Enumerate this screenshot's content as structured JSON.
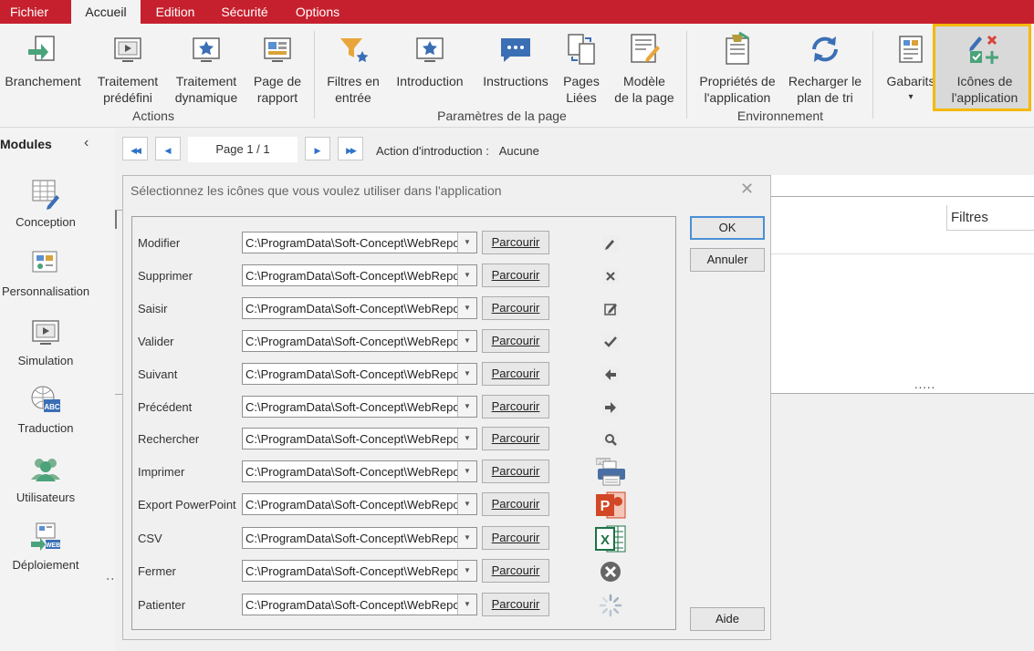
{
  "tabs": [
    {
      "label": "Fichier",
      "active": false
    },
    {
      "label": "Accueil",
      "active": true
    },
    {
      "label": "Edition",
      "active": false
    },
    {
      "label": "Sécurité",
      "active": false
    },
    {
      "label": "Options",
      "active": false
    }
  ],
  "ribbon": {
    "actions": {
      "group_label": "Actions",
      "branchement": "Branchement",
      "traitement_predefini_1": "Traitement",
      "traitement_predefini_2": "prédéfini",
      "traitement_dynamique_1": "Traitement",
      "traitement_dynamique_2": "dynamique",
      "page_rapport_1": "Page de",
      "page_rapport_2": "rapport"
    },
    "page_params": {
      "group_label": "Paramètres de la page",
      "filtres_1": "Filtres en",
      "filtres_2": "entrée",
      "introduction": "Introduction",
      "instructions": "Instructions",
      "pages_liees_1": "Pages",
      "pages_liees_2": "Liées",
      "modele_1": "Modèle",
      "modele_2": "de la page"
    },
    "environnement": {
      "group_label": "Environnement",
      "proprietes_1": "Propriétés de",
      "proprietes_2": "l'application",
      "recharger_1": "Recharger le",
      "recharger_2": "plan de tri"
    },
    "gabarits": "Gabarits",
    "gabarits_arrow": "▾",
    "icones_1": "Icônes de",
    "icones_2": "l'application"
  },
  "modules": {
    "title": "Modules",
    "collapse": "‹",
    "items": [
      {
        "label": "Conception",
        "icon": "conception-icon"
      },
      {
        "label": "Personnalisation",
        "icon": "personnalisation-icon"
      },
      {
        "label": "Simulation",
        "icon": "simulation-icon"
      },
      {
        "label": "Traduction",
        "icon": "traduction-icon"
      },
      {
        "label": "Utilisateurs",
        "icon": "users-icon"
      },
      {
        "label": "Déploiement",
        "icon": "deploiement-icon"
      }
    ],
    "abc": "ABC",
    "web": "WEB"
  },
  "nav": {
    "first": "◀◀",
    "prev": "◀",
    "page": "Page 1 / 1",
    "next": "▶",
    "last": "▶▶",
    "action_label": "Action d'introduction :",
    "action_value": "Aucune"
  },
  "background": {
    "filtres_header": "Filtres",
    "dots": "....."
  },
  "dialog": {
    "title": "Sélectionnez les icônes que vous voulez utiliser dans l'application",
    "close": "✕",
    "ok": "OK",
    "cancel": "Annuler",
    "help": "Aide",
    "browse_label": "Parcourir",
    "combo_arrow": "▼",
    "rows": [
      {
        "label": "Modifier",
        "path": "C:\\ProgramData\\Soft-Concept\\WebReport",
        "icon": "pencil-icon"
      },
      {
        "label": "Supprimer",
        "path": "C:\\ProgramData\\Soft-Concept\\WebReport",
        "icon": "delete-x-icon"
      },
      {
        "label": "Saisir",
        "path": "C:\\ProgramData\\Soft-Concept\\WebReport",
        "icon": "edit-box-icon"
      },
      {
        "label": "Valider",
        "path": "C:\\ProgramData\\Soft-Concept\\WebReport",
        "icon": "checkmark-icon"
      },
      {
        "label": "Suivant",
        "path": "C:\\ProgramData\\Soft-Concept\\WebReport",
        "icon": "arrow-left-icon"
      },
      {
        "label": "Précédent",
        "path": "C:\\ProgramData\\Soft-Concept\\WebReport",
        "icon": "arrow-right-icon"
      },
      {
        "label": "Rechercher",
        "path": "C:\\ProgramData\\Soft-Concept\\WebReport",
        "icon": "magnifier-icon"
      },
      {
        "label": "Imprimer",
        "path": "C:\\ProgramData\\Soft-Concept\\WebReport",
        "icon": "pdf-printer-icon"
      },
      {
        "label": "Export PowerPoint",
        "path": "C:\\ProgramData\\Soft-Concept\\WebReport",
        "icon": "powerpoint-icon"
      },
      {
        "label": "CSV",
        "path": "C:\\ProgramData\\Soft-Concept\\WebReport",
        "icon": "excel-icon"
      },
      {
        "label": "Fermer",
        "path": "C:\\ProgramData\\Soft-Concept\\WebReport",
        "icon": "close-circle-icon"
      },
      {
        "label": "Patienter",
        "path": "C:\\ProgramData\\Soft-Concept\\WebReport",
        "icon": "spinner-icon"
      }
    ],
    "icon_texts": {
      "pdf": "PDF",
      "ppt": "P",
      "xls": "X"
    }
  },
  "colors": {
    "tabbar": "#c6202e",
    "highlight": "#f5b800",
    "accent_blue": "#2f73c9"
  }
}
